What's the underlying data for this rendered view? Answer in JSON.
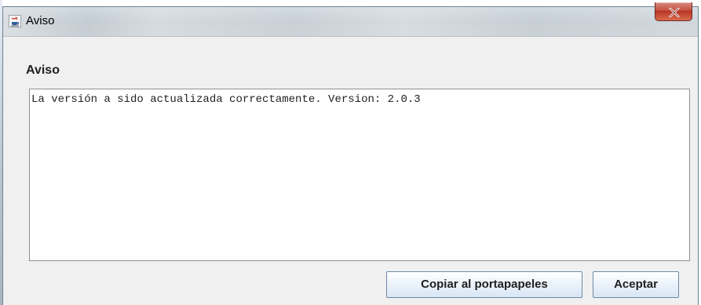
{
  "window": {
    "title": "Aviso"
  },
  "dialog": {
    "heading": "Aviso",
    "message": "La versión a sido actualizada correctamente. Version: 2.0.3"
  },
  "buttons": {
    "copy": "Copiar al portapapeles",
    "accept": "Aceptar"
  },
  "icons": {
    "title": "java-cup-icon",
    "close": "close-icon"
  },
  "colors": {
    "close_button": "#c65342",
    "button_border": "#6f8aa7"
  }
}
